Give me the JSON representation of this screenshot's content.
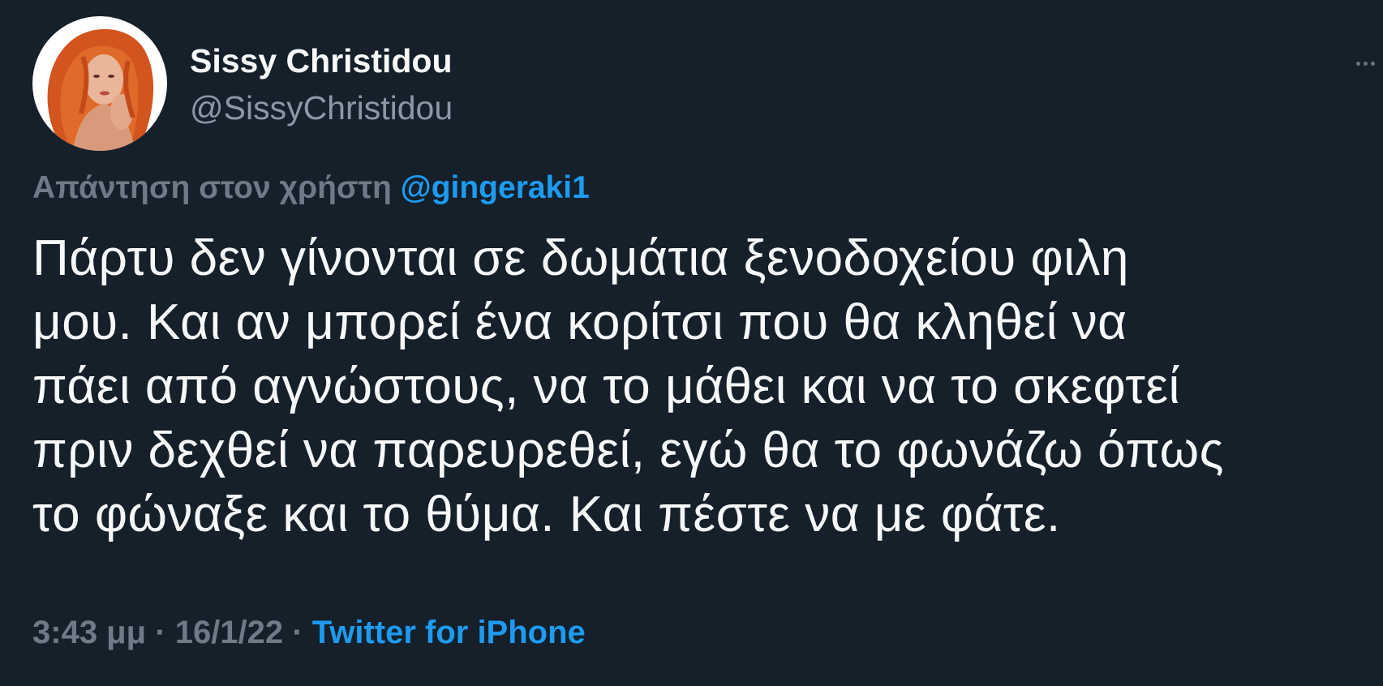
{
  "author": {
    "name": "Sissy Christidou",
    "handle": "@SissyChristidou"
  },
  "reply": {
    "prefix": "Απάντηση στον χρήστη",
    "mention": "@gingeraki1"
  },
  "tweet": {
    "lines": [
      "Πάρτυ δεν γίνονται σε δωμάτια ξενοδοχείου φιλη",
      "μου. Και αν μπορεί ένα κορίτσι που θα κληθεί να",
      "πάει από αγνώστους, να το μάθει και να το σκεφτεί",
      "πριν δεχθεί να παρευρεθεί, εγώ θα το φωνάζω όπως",
      "το φώναξε και το θύμα. Και πέστε να με φάτε."
    ]
  },
  "meta": {
    "time": "3:43 μμ",
    "separator": "·",
    "date": "16/1/22",
    "source": "Twitter for iPhone"
  },
  "icons": {
    "more": "more-horizontal-icon",
    "avatar": "profile-photo"
  },
  "colors": {
    "background": "#15202b",
    "text": "#f7f9f9",
    "secondary": "#8b98a5",
    "accent": "#1d9bf0"
  }
}
